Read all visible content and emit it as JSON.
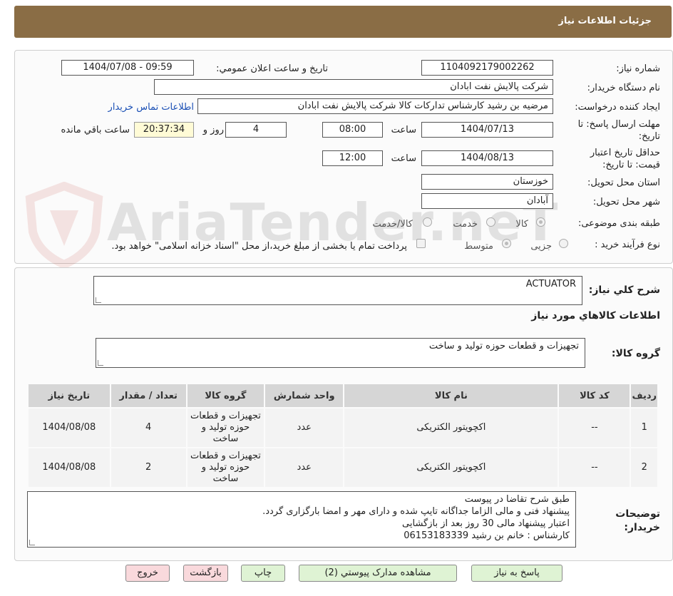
{
  "header": {
    "title": "جزئیات اطلاعات نیاز"
  },
  "watermark": {
    "text": "AriaTender.neT"
  },
  "form": {
    "need_number_label": "شماره نیاز:",
    "need_number": "1104092179002262",
    "announce_label": "تاریخ و ساعت اعلان عمومي:",
    "announce_value": "1404/07/08 - 09:59",
    "buyer_org_label": "نام دستگاه خریدار:",
    "buyer_org": "شرکت پالايش نفت ابادان",
    "creator_label": "ایجاد کننده درخواست:",
    "creator": "مرضيه بن رشيد كارشناس تداركات كالا  شرکت پالايش نفت ابادان",
    "contact_link": "اطلاعات تماس خریدار",
    "deadline_label": "مهلت ارسال پاسخ: تا تاریخ:",
    "deadline_date": "1404/07/13",
    "time_label": "ساعت",
    "deadline_time": "08:00",
    "days_value": "4",
    "days_label": "روز و",
    "remaining_time": "20:37:34",
    "remaining_label": "ساعت باقي مانده",
    "validity_label": "حداقل تاریخ اعتبار قیمت: تا تاریخ:",
    "validity_date": "1404/08/13",
    "validity_time": "12:00",
    "province_label": "استان محل تحویل:",
    "province": "خوزستان",
    "city_label": "شهر محل تحویل:",
    "city": "آبادان",
    "category_label": "طبقه بندی موضوعی:",
    "category_options": [
      "کالا",
      "خدمت",
      "کالا/خدمت"
    ],
    "process_label": "نوع فرآیند خرید :",
    "process_options": [
      "جزیی",
      "متوسط"
    ],
    "treasury_note": "پرداخت تمام یا بخشی از مبلغ خرید،از محل \"اسناد خزانه اسلامی\" خواهد بود."
  },
  "details": {
    "summary_label": "شرح کلي نیاز:",
    "summary": "ACTUATOR",
    "goods_info_title": "اطلاعات کالاهاي مورد نیاز",
    "group_label": "گروه کالا:",
    "group": "تجهیزات و قطعات حوزه تولید و ساخت",
    "table": {
      "headers": [
        "ردیف",
        "کد کالا",
        "نام کالا",
        "واحد شمارش",
        "گروه کالا",
        "تعداد / مقدار",
        "تاریخ نیاز"
      ],
      "rows": [
        [
          "1",
          "--",
          "اکچویتور الکتریکی",
          "عدد",
          "تجهیزات و قطعات حوزه تولید و ساخت",
          "4",
          "1404/08/08"
        ],
        [
          "2",
          "--",
          "اکچویتور الکتریکی",
          "عدد",
          "تجهیزات و قطعات حوزه تولید و ساخت",
          "2",
          "1404/08/08"
        ]
      ]
    },
    "buyer_notes_label": "توضیحات خریدار:",
    "buyer_notes": [
      "طبق شرح تقاضا در پیوست",
      "پیشنهاد فنی و مالی الزاما جداگانه تایپ شده و دارای مهر و امضا بارگزاری گردد.",
      "اعتبار پیشنهاد مالی 30 روز بعد از بازگشایی",
      "کارشناس :  خانم بن رشید 06153183339"
    ]
  },
  "buttons": {
    "reply": "پاسخ به نیاز",
    "attachments": "مشاهده مدارک پیوستي (2)",
    "print": "چاپ",
    "back": "بازگشت",
    "exit": "خروج"
  },
  "colors": {
    "header_bg": "#8a6d45",
    "timer_bg": "#fffbd6",
    "green_btn": "#dff3d4",
    "pink_btn": "#f9d9dc",
    "link": "#1a4fb5"
  }
}
